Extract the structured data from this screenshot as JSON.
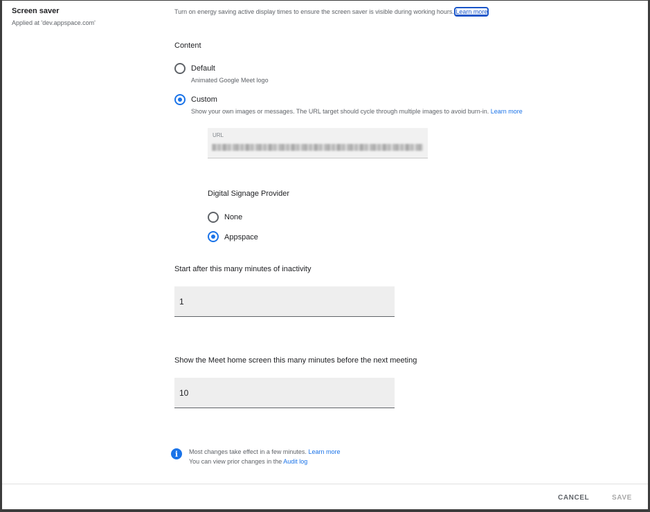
{
  "setting": {
    "title": "Screen saver",
    "applied_at": "Applied at 'dev.appspace.com'",
    "description": "Turn on energy saving active display times to ensure the screen saver is visible during working hours.",
    "description_link": "Learn more"
  },
  "content": {
    "heading": "Content",
    "options": [
      {
        "label": "Default",
        "helper": "Animated Google Meet logo",
        "checked": false
      },
      {
        "label": "Custom",
        "helper": "Show your own images or messages. The URL target should cycle through multiple images to avoid burn-in.",
        "helper_link": "Learn more",
        "checked": true
      }
    ],
    "url_field": {
      "label": "URL",
      "value_obscured": true
    }
  },
  "signage": {
    "heading": "Digital Signage Provider",
    "options": [
      {
        "label": "None",
        "checked": false
      },
      {
        "label": "Appspace",
        "checked": true
      }
    ]
  },
  "inactivity": {
    "label": "Start after this many minutes of inactivity",
    "value": "1"
  },
  "home_screen": {
    "label": "Show the Meet home screen this many minutes before the next meeting",
    "value": "10"
  },
  "info": {
    "icon": "info-icon",
    "line1": "Most changes take effect in a few minutes.",
    "line1_link": "Learn more",
    "line2": "You can view prior changes in the",
    "line2_link": "Audit log"
  },
  "footer": {
    "cancel_label": "CANCEL",
    "save_label": "SAVE"
  },
  "colors": {
    "accent": "#1a73e8",
    "disabled": "#a8a8a8"
  }
}
